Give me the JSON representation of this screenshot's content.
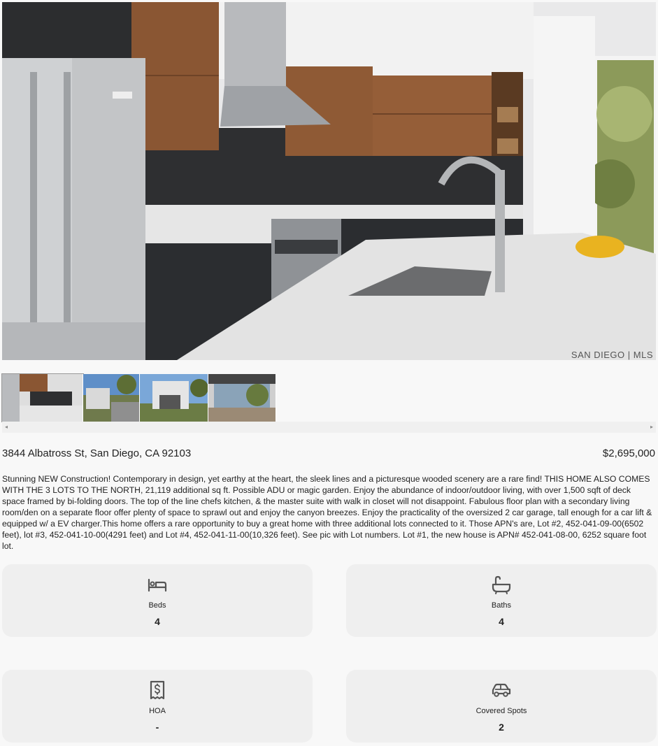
{
  "listing": {
    "address": "3844 Albatross St, San Diego, CA 92103",
    "price": "$2,695,000",
    "description": "Stunning NEW Construction! Contemporary in design, yet earthy at the heart, the sleek lines and a picturesque wooded scenery are a rare find! THIS HOME ALSO COMES WITH THE 3 LOTS TO THE NORTH, 21,119 additional sq ft. Possible ADU or magic garden. Enjoy the abundance of indoor/outdoor living, with over 1,500 sqft of deck space framed by bi-folding doors. The top of the line chefs kitchen, & the master suite with walk in closet will not disappoint. Fabulous floor plan with a secondary living room/den on a separate floor offer plenty of space to sprawl out and enjoy the canyon breezes. Enjoy the practicality of the oversized 2 car garage, tall enough for a car lift & equipped w/ a EV charger.This home offers a rare opportunity to buy a great home with three additional lots connected to it. Those APN's are, Lot #2, 452-041-09-00(6502 feet), lot #3, 452-041-10-00(4291 feet) and Lot #4, 452-041-11-00(10,326 feet). See pic with Lot numbers. Lot #1, the new house is APN# 452-041-08-00, 6252 square foot lot."
  },
  "photo": {
    "watermark": "SAN DIEGO | MLS",
    "thumbnail_count": 4
  },
  "stats": {
    "beds": {
      "label": "Beds",
      "value": "4",
      "icon": "bed-icon"
    },
    "baths": {
      "label": "Baths",
      "value": "4",
      "icon": "bathtub-icon"
    },
    "hoa": {
      "label": "HOA",
      "value": "-",
      "icon": "receipt-dollar-icon"
    },
    "covered_spots": {
      "label": "Covered Spots",
      "value": "2",
      "icon": "car-icon"
    }
  },
  "scrollbar": {
    "left_arrow": "◂",
    "right_arrow": "▸"
  }
}
